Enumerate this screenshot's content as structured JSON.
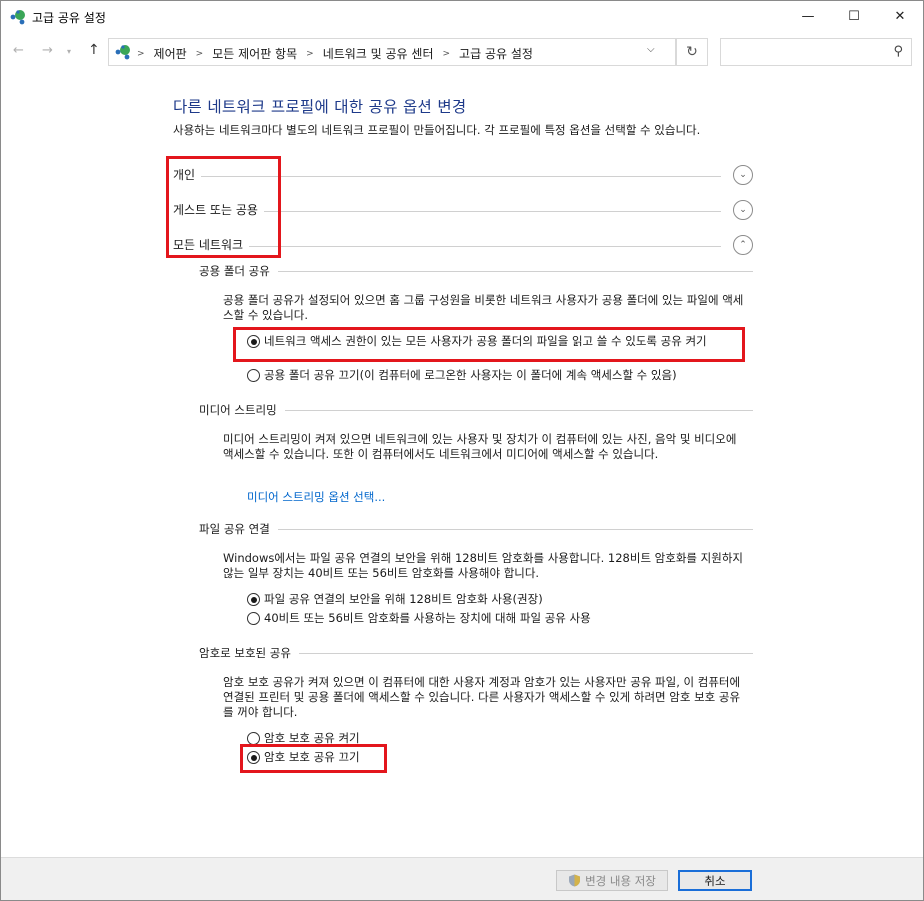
{
  "window": {
    "title": "고급 공유 설정",
    "minimize": "—",
    "maximize": "☐",
    "close": "✕"
  },
  "nav": {
    "back": "←",
    "forward": "→",
    "dropdown": "▾",
    "up": "↑",
    "breadcrumbs": [
      "제어판",
      "모든 제어판 항목",
      "네트워크 및 공유 센터",
      "고급 공유 설정"
    ],
    "separator": ">",
    "refresh": "↻",
    "chevron": "⌵",
    "search_placeholder": "",
    "search_icon": "⚲"
  },
  "main": {
    "title": "다른 네트워크 프로필에 대한 공유 옵션 변경",
    "description": "사용하는 네트워크마다 별도의 네트워크 프로필이 만들어집니다. 각 프로필에 특정 옵션을 선택할 수 있습니다.",
    "profiles": [
      {
        "label": "개인",
        "state": "collapsed",
        "icon": "⌄"
      },
      {
        "label": "게스트 또는 공용",
        "state": "collapsed",
        "icon": "⌄"
      },
      {
        "label": "모든 네트워크",
        "state": "expanded",
        "icon": "⌃"
      }
    ]
  },
  "sections": {
    "public_folder": {
      "label": "공용 폴더 공유",
      "desc": "공용 폴더 공유가 설정되어 있으면 홈 그룹 구성원을 비롯한 네트워크 사용자가 공용 폴더에 있는 파일에 액세스할 수 있습니다.",
      "opt_on": "네트워크 액세스 권한이 있는 모든 사용자가 공용 폴더의 파일을 읽고 쓸 수 있도록 공유 켜기",
      "opt_off": "공용 폴더 공유 끄기(이 컴퓨터에 로그온한 사용자는 이 폴더에 계속 액세스할 수 있음)",
      "selected": "on"
    },
    "media": {
      "label": "미디어 스트리밍",
      "desc": "미디어 스트리밍이 켜져 있으면 네트워크에 있는 사용자 및 장치가 이 컴퓨터에 있는 사진, 음악 및 비디오에 액세스할 수 있습니다. 또한 이 컴퓨터에서도 네트워크에서 미디어에 액세스할 수 있습니다.",
      "link": "미디어 스트리밍 옵션 선택..."
    },
    "file_sharing": {
      "label": "파일 공유 연결",
      "desc": "Windows에서는 파일 공유 연결의 보안을 위해 128비트 암호화를 사용합니다. 128비트 암호화를 지원하지 않는 일부 장치는 40비트 또는 56비트 암호화를 사용해야 합니다.",
      "opt_128": "파일 공유 연결의 보안을 위해 128비트 암호화 사용(권장)",
      "opt_40": "40비트 또는 56비트 암호화를 사용하는 장치에 대해 파일 공유 사용",
      "selected": "128"
    },
    "password": {
      "label": "암호로 보호된 공유",
      "desc": "암호 보호 공유가 켜져 있으면 이 컴퓨터에 대한 사용자 계정과 암호가 있는 사용자만 공유 파일, 이 컴퓨터에 연결된 프린터 및 공용 폴더에 액세스할 수 있습니다. 다른 사용자가 액세스할 수 있게 하려면 암호 보호 공유를 꺼야 합니다.",
      "opt_on": "암호 보호 공유 켜기",
      "opt_off": "암호 보호 공유 끄기",
      "selected": "off"
    }
  },
  "footer": {
    "save": "변경 내용 저장",
    "cancel": "취소"
  },
  "colors": {
    "title_blue": "#1e3a8a",
    "link_blue": "#0066cc",
    "highlight_red": "#e3161c",
    "focus_blue": "#1a6ed8"
  }
}
